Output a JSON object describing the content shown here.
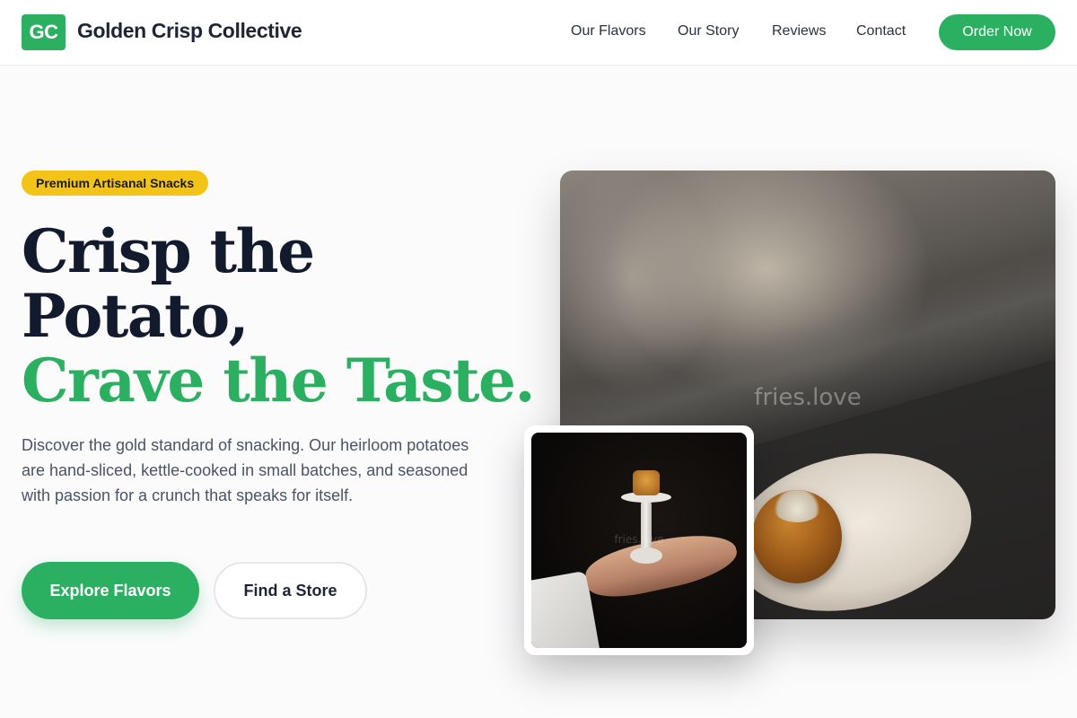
{
  "header": {
    "logo_text": "GC",
    "brand_name": "Golden Crisp Collective",
    "nav": [
      {
        "label": "Our Flavors"
      },
      {
        "label": "Our Story"
      },
      {
        "label": "Reviews"
      },
      {
        "label": "Contact"
      }
    ],
    "cta_label": "Order Now"
  },
  "hero": {
    "badge": "Premium Artisanal Snacks",
    "headline_line1": "Crisp the",
    "headline_line2": "Potato,",
    "headline_line3": "Crave the Taste.",
    "description": "Discover the gold standard of snacking. Our heirloom potatoes are hand-sliced, kettle-cooked in small batches, and seasoned with passion for a crunch that speaks for itself.",
    "primary_button": "Explore Flavors",
    "secondary_button": "Find a Store",
    "main_image_watermark": "fries.love",
    "inset_image_watermark": "fries.love"
  },
  "colors": {
    "accent": "#2bb062",
    "badge": "#f4c317",
    "heading": "#121a2e",
    "body_text": "#4a5365"
  }
}
